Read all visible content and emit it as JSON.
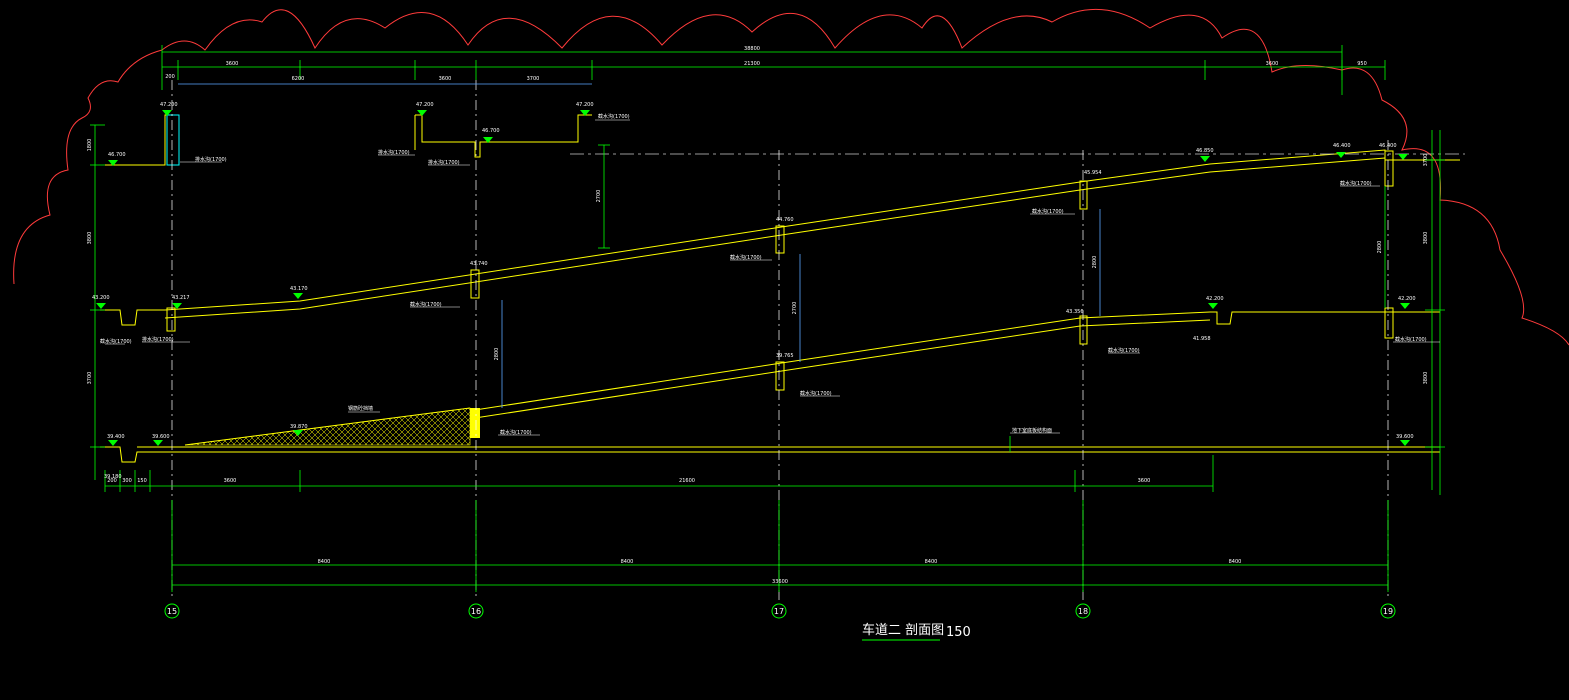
{
  "title": {
    "name": "车道二 剖面图",
    "scale": "150"
  },
  "grid_axes": [
    "15",
    "16",
    "17",
    "18",
    "19"
  ],
  "dimensions": {
    "top_total": "38800",
    "top_row": [
      "200",
      "3600",
      "6200",
      "3600",
      "3700",
      "21300",
      "3600",
      "950"
    ],
    "bottom_row": [
      "8400",
      "8400",
      "8400",
      "8400"
    ],
    "bottom_total": "33600",
    "floor_row": [
      "200",
      "300",
      "150",
      "3600",
      "21600",
      "3600"
    ],
    "left_vertical": [
      "1800",
      "3800",
      "3700"
    ],
    "right_vertical": [
      "3800",
      "3800",
      "3700"
    ],
    "clear_heights": [
      "2700",
      "2800",
      "2700",
      "2800",
      "2800"
    ]
  },
  "elevations": [
    "47.200",
    "47.200",
    "47.200",
    "46.700",
    "46.700",
    "46.850",
    "46.400",
    "46.400",
    "43.200",
    "43.217",
    "43.170",
    "43.740",
    "44.760",
    "45.954",
    "43.356",
    "42.200",
    "41.958",
    "42.200",
    "39.180",
    "39.765",
    "39.600",
    "39.870",
    "39.600",
    "39.400"
  ],
  "annotations": [
    "排水沟(1700)",
    "排水沟(1700)",
    "排水沟(1700)",
    "截水沟(1700)",
    "排水沟(1700)",
    "截水沟(1700)",
    "截水沟(1700)",
    "截水沟(1700)",
    "截水沟(1700)",
    "截水沟(1700)",
    "截水沟(1700)",
    "截水沟(1700)",
    "截水沟(1700)",
    "截水沟(1700)",
    "钢筋砼挡墙",
    "地下室底板结构面"
  ],
  "colors": {
    "background": "#000000",
    "ramp": "#ffff00",
    "dimension": "#00ff00",
    "axis_line": "#ffffff",
    "cloud": "#ff3b3b",
    "cyan": "#00ffff",
    "marker": "#00ff00"
  }
}
